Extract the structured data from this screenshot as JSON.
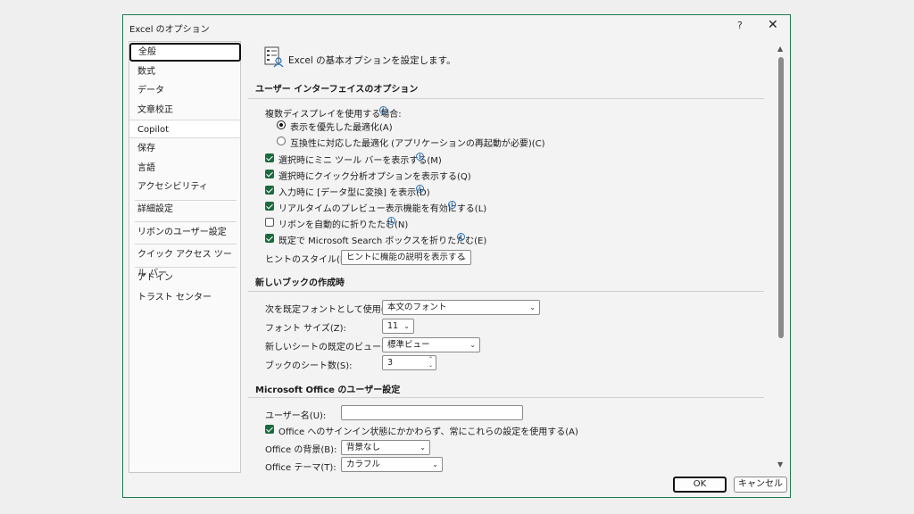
{
  "window": {
    "title": "Excel のオプション",
    "help": "?",
    "close": "✕"
  },
  "nav": {
    "items": [
      "全般",
      "数式",
      "データ",
      "文章校正",
      "Copilot",
      "保存",
      "言語",
      "アクセシビリティ",
      "詳細設定",
      "リボンのユーザー設定",
      "クイック アクセス ツール バー",
      "アドイン",
      "トラスト センター"
    ],
    "selected": "全般"
  },
  "header": {
    "text": "Excel の基本オプションを設定します。"
  },
  "ui_section": {
    "title": "ユーザー インターフェイスのオプション",
    "multi_display_label": "複数ディスプレイを使用する場合:",
    "radio_appearance": "表示を優先した最適化(A)",
    "radio_compat": "互換性に対応した最適化 (アプリケーションの再起動が必要)(C)",
    "cb_mini_toolbar": "選択時にミニ ツール バーを表示する(M)",
    "cb_quick_analysis": "選択時にクイック分析オプションを表示する(Q)",
    "cb_convert_data": "入力時に [データ型に変換] を表示(D)",
    "cb_live_preview": "リアルタイムのプレビュー表示機能を有効にする(L)",
    "cb_collapse_ribbon": "リボンを自動的に折りたたむ(N)",
    "cb_collapse_search": "既定で Microsoft Search ボックスを折りたたむ(E)",
    "tooltip_label": "ヒントのスタイル(R):",
    "tooltip_value": "ヒントに機能の説明を表示する"
  },
  "workbook_section": {
    "title": "新しいブックの作成時",
    "font_label": "次を既定フォントとして使用(N):",
    "font_value": "本文のフォント",
    "size_label": "フォント サイズ(Z):",
    "size_value": "11",
    "view_label": "新しいシートの既定のビュー(V):",
    "view_value": "標準ビュー",
    "sheets_label": "ブックのシート数(S):",
    "sheets_value": "3"
  },
  "office_section": {
    "title": "Microsoft Office のユーザー設定",
    "username_label": "ユーザー名(U):",
    "username_value": "",
    "cb_always_use": "Office へのサインイン状態にかかわらず、常にこれらの設定を使用する(A)",
    "background_label": "Office の背景(B):",
    "background_value": "背景なし",
    "theme_label": "Office テーマ(T):",
    "theme_value": "カラフル"
  },
  "buttons": {
    "ok": "OK",
    "cancel": "キャンセル"
  },
  "colors": {
    "accent": "#1a6b3c",
    "info": "#2b6fb6",
    "border": "#1f7a4d"
  }
}
